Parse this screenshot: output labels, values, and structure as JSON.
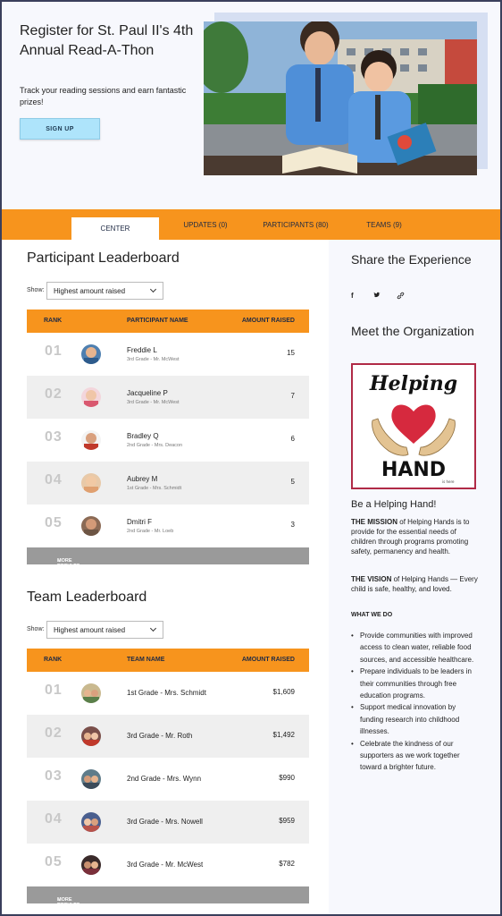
{
  "hero": {
    "title": "Register for St. Paul II's 4th Annual Read-A-Thon",
    "subtitle": "Track your reading sessions and earn fantastic prizes!",
    "signup_label": "SIGN UP"
  },
  "nav": {
    "tabs": [
      {
        "label": "CENTER",
        "active": true
      },
      {
        "label": "UPDATES (0)",
        "active": false
      },
      {
        "label": "PARTICIPANTS (80)",
        "active": false
      },
      {
        "label": "TEAMS (9)",
        "active": false
      }
    ],
    "accent_color": "#f7941d"
  },
  "participant_board": {
    "title": "Participant Leaderboard",
    "show_label": "Show:",
    "select_value": "Highest amount raised",
    "columns": [
      "RANK",
      "PARTICIPANT NAME",
      "AMOUNT RAISED"
    ],
    "rows": [
      {
        "rank": "01",
        "name": "Freddie L",
        "sub": "3rd Grade - Mr. McWest",
        "amount": "15"
      },
      {
        "rank": "02",
        "name": "Jacqueline P",
        "sub": "3rd Grade - Mr. McWest",
        "amount": "7"
      },
      {
        "rank": "03",
        "name": "Bradley Q",
        "sub": "2nd Grade - Mrs. Deacon",
        "amount": "6"
      },
      {
        "rank": "04",
        "name": "Aubrey M",
        "sub": "1st Grade - Mrs. Schmidt",
        "amount": "5"
      },
      {
        "rank": "05",
        "name": "Dmitri F",
        "sub": "2nd Grade - Mr. Loeb",
        "amount": "3"
      }
    ],
    "more_label": "MORE RESULTS"
  },
  "team_board": {
    "title": "Team Leaderboard",
    "show_label": "Show:",
    "select_value": "Highest amount raised",
    "columns": [
      "RANK",
      "TEAM NAME",
      "AMOUNT RAISED"
    ],
    "rows": [
      {
        "rank": "01",
        "name": "1st Grade - Mrs. Schmidt",
        "amount": "$1,609"
      },
      {
        "rank": "02",
        "name": "3rd Grade - Mr. Roth",
        "amount": "$1,492"
      },
      {
        "rank": "03",
        "name": "2nd Grade - Mrs. Wynn",
        "amount": "$990"
      },
      {
        "rank": "04",
        "name": "3rd Grade - Mrs. Nowell",
        "amount": "$959"
      },
      {
        "rank": "05",
        "name": "3rd Grade - Mr. McWest",
        "amount": "$782"
      }
    ],
    "more_label": "MORE RESULTS"
  },
  "sidebar": {
    "share_title": "Share the Experience",
    "social_icons": [
      "facebook-icon",
      "twitter-icon",
      "link-icon"
    ],
    "meet_title": "Meet the Organization",
    "logo_text": {
      "top": "Helping",
      "bottom": "HAND",
      "tag": "is here"
    },
    "help_title": "Be a Helping Hand!",
    "mission_label": "THE MISSION",
    "mission_text": " of  Helping Hands is to provide for the essential needs of children through programs promoting safety, permanency and health.",
    "vision_label": "THE VISION",
    "vision_text": " of  Helping Hands — Every child is safe, healthy, and loved.",
    "what_we_do": "WHAT WE DO",
    "bullets": [
      "Provide communities with improved access to clean water, reliable food sources, and accessible healthcare.",
      "Prepare individuals to be leaders in their communities through free education programs.",
      "Support medical innovation by funding research into childhood illnesses.",
      "Celebrate the kindness of our supporters as we work together toward a brighter future."
    ]
  }
}
